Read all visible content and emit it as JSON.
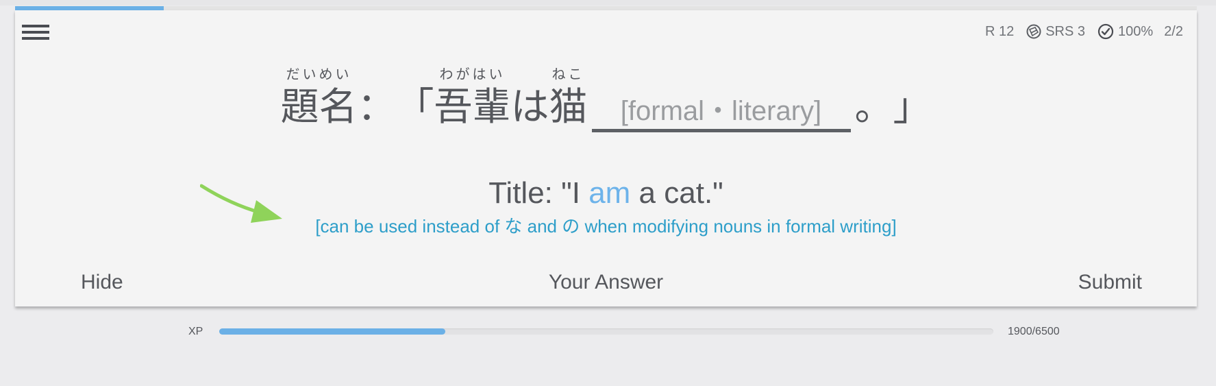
{
  "session_progress": 0.126,
  "stats": {
    "review_label": "R 12",
    "srs_label": "SRS 3",
    "accuracy_label": "100%",
    "count_label": "2/2"
  },
  "question": {
    "title_base": "題名",
    "title_furigana": "だいめい",
    "colon": "：",
    "open_quote": "「",
    "wagahai_base": "吾輩",
    "wagahai_furigana": "わがはい",
    "particle": "は",
    "neko_base": "猫",
    "neko_furigana": "ねこ",
    "blank_placeholder": "[formal・literary]",
    "period": "。",
    "close_quote": "」"
  },
  "translation": {
    "before": "Title: \"I ",
    "highlight": "am",
    "after": " a cat.\""
  },
  "hint_text": "[can be used instead of な and の when modifying nouns in formal writing]",
  "buttons": {
    "hide": "Hide",
    "your_answer": "Your Answer",
    "submit": "Submit"
  },
  "xp": {
    "label": "XP",
    "current": 1900,
    "total": 6500,
    "count_text": "1900/6500"
  },
  "colors": {
    "accent_blue": "#6bb0e6",
    "hint_teal": "#2d9ec9",
    "arrow_green": "#8fd35a",
    "text_gray": "#55575c"
  }
}
